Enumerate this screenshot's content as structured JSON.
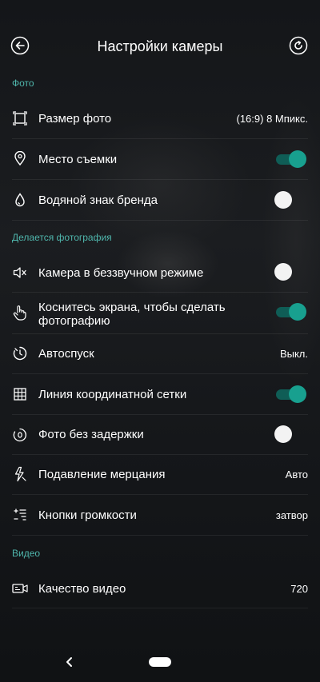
{
  "header": {
    "title": "Настройки камеры"
  },
  "sections": {
    "photo": "Фото",
    "capturing": "Делается фотография",
    "video": "Видео"
  },
  "rows": {
    "photo_size": {
      "label": "Размер фото",
      "value": "(16:9) 8 Мпикс.",
      "icon": "crop-frame-icon"
    },
    "location": {
      "label": "Место съемки",
      "toggle": "on",
      "icon": "location-pin-icon"
    },
    "watermark": {
      "label": "Водяной знак бренда",
      "toggle": "off",
      "icon": "water-drop-icon"
    },
    "silent": {
      "label": "Камера в беззвучном режиме",
      "toggle": "off",
      "icon": "speaker-mute-icon"
    },
    "touch_capture": {
      "label": "Коснитесь экрана, чтобы сделать фотографию",
      "toggle": "on",
      "icon": "touch-hand-icon"
    },
    "timer": {
      "label": "Автоспуск",
      "value": "Выкл.",
      "icon": "timer-icon"
    },
    "grid": {
      "label": "Линия координатной сетки",
      "toggle": "on",
      "icon": "grid-icon"
    },
    "zero_lag": {
      "label": "Фото без задержки",
      "toggle": "off",
      "icon": "zero-lag-icon"
    },
    "flicker": {
      "label": "Подавление мерцания",
      "value": "Авто",
      "icon": "flicker-icon"
    },
    "volume_keys": {
      "label": "Кнопки громкости",
      "value": "затвор",
      "icon": "volume-keys-icon"
    },
    "video_quality": {
      "label": "Качество видео",
      "value": "720",
      "icon": "video-camera-icon"
    }
  },
  "colors": {
    "accent": "#4fb6ac",
    "toggle_on": "#18a08f",
    "toggle_off": "#f3f3f3"
  }
}
